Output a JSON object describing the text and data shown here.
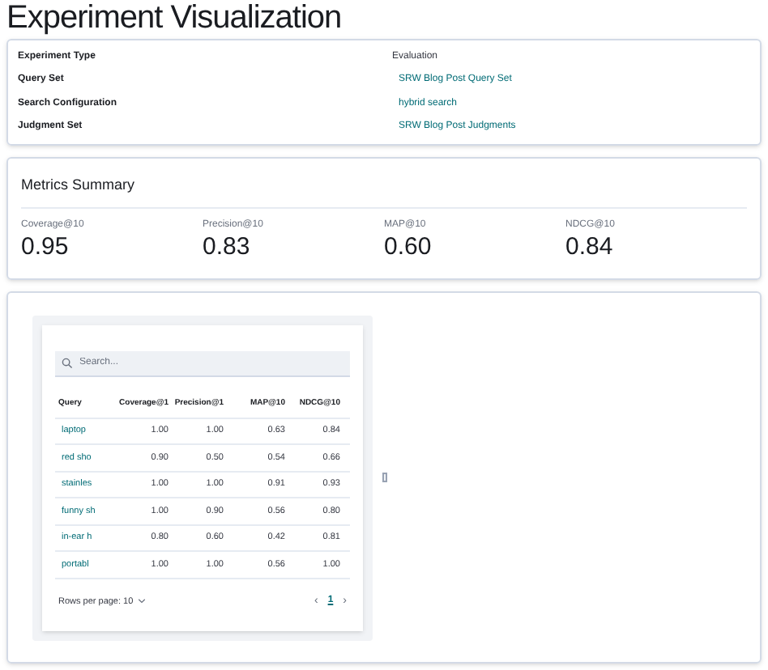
{
  "title": "Experiment Visualization",
  "details": [
    {
      "label": "Experiment Type",
      "value": "Evaluation",
      "kind": "text"
    },
    {
      "label": "Query Set",
      "value": "SRW Blog Post Query Set",
      "kind": "link"
    },
    {
      "label": "Search Configuration",
      "value": "hybrid search",
      "kind": "link"
    },
    {
      "label": "Judgment Set",
      "value": "SRW Blog Post Judgments",
      "kind": "link"
    }
  ],
  "metrics_summary": {
    "title": "Metrics Summary",
    "metrics": [
      {
        "label": "Coverage@10",
        "value": "0.95"
      },
      {
        "label": "Precision@10",
        "value": "0.83"
      },
      {
        "label": "MAP@10",
        "value": "0.60"
      },
      {
        "label": "NDCG@10",
        "value": "0.84"
      }
    ]
  },
  "table": {
    "search": {
      "placeholder": "Search..."
    },
    "columns": [
      "Query",
      "Coverage@1",
      "Precision@1",
      "MAP@10",
      "NDCG@10"
    ],
    "rows": [
      [
        "laptop",
        "1.00",
        "1.00",
        "0.63",
        "0.84"
      ],
      [
        "red sho",
        "0.90",
        "0.50",
        "0.54",
        "0.66"
      ],
      [
        "stainles",
        "1.00",
        "1.00",
        "0.91",
        "0.93"
      ],
      [
        "funny sh",
        "1.00",
        "0.90",
        "0.56",
        "0.80"
      ],
      [
        "in-ear h",
        "0.80",
        "0.60",
        "0.42",
        "0.81"
      ],
      [
        "portabl",
        "1.00",
        "1.00",
        "0.56",
        "1.00"
      ]
    ],
    "rows_per_page": "Rows per page: 10",
    "pagination": {
      "prev": "‹",
      "next": "›",
      "pages": [
        {
          "label": "1",
          "selected": true
        }
      ]
    }
  }
}
